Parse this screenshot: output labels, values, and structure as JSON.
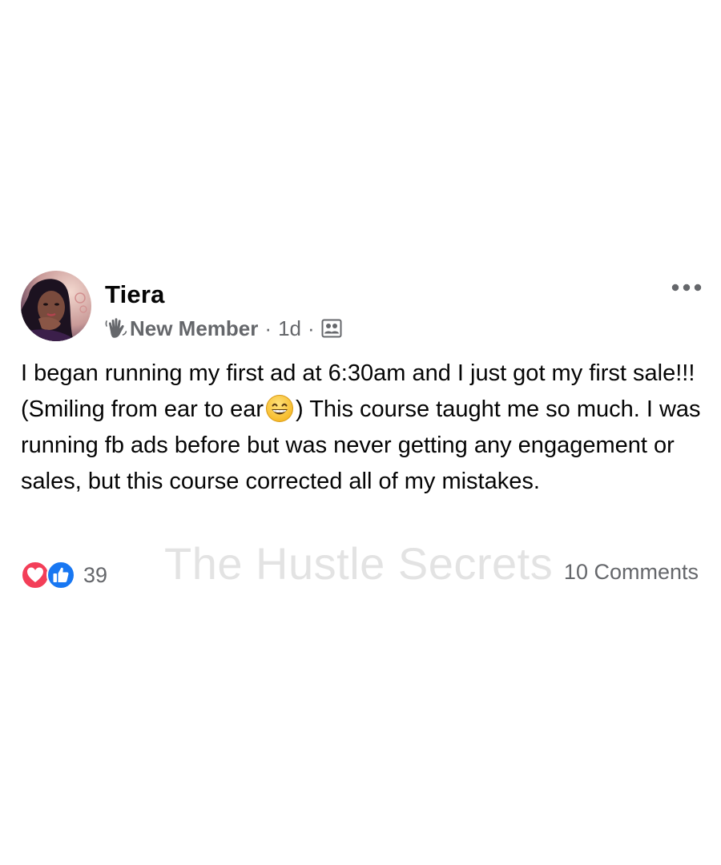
{
  "post": {
    "author": {
      "name": "Tiera",
      "badge_icon": "waving-hand-icon",
      "badge_label": "New Member"
    },
    "meta": {
      "separator": "·",
      "time": "1d",
      "audience_icon": "group-members-icon"
    },
    "body": {
      "line_before_emoji": "I began running my first ad at 6:30am and I just got my first sale!!! (Smiling from ear to ear",
      "emoji": "grinning-face-with-smiling-eyes",
      "line_after_emoji": ") This course taught me so much. I was running fb ads before but was never getting any engagement or sales, but this course corrected all of my mistakes."
    },
    "reactions": {
      "icons": [
        "love-reaction-icon",
        "like-reaction-icon"
      ],
      "count": "39"
    },
    "comments_label": "10 Comments",
    "watermark": "The Hustle Secrets",
    "more_icon": "more-options-icon"
  },
  "colors": {
    "text_primary": "#050505",
    "text_secondary": "#65676b",
    "love_red": "#f33e58",
    "like_blue": "#1877f2",
    "watermark_gray": "#e3e3e3"
  }
}
